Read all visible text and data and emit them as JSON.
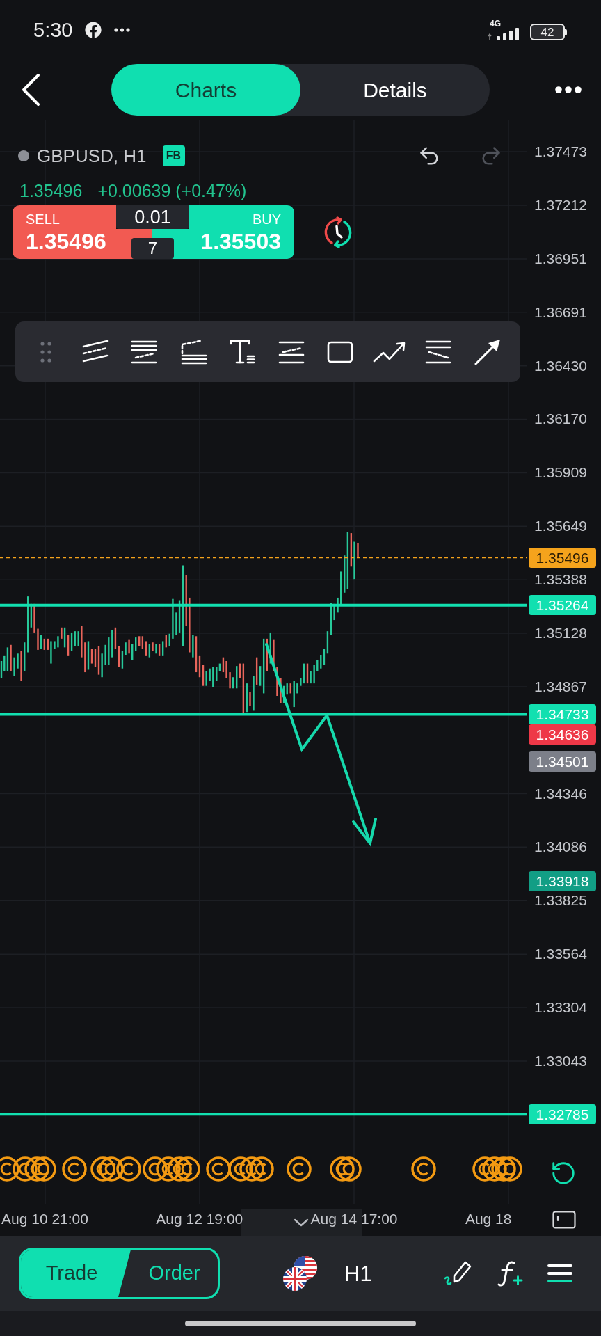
{
  "status_bar": {
    "time": "5:30",
    "network": "4G",
    "battery": "42"
  },
  "header": {
    "tabs": [
      {
        "label": "Charts",
        "selected": true
      },
      {
        "label": "Details",
        "selected": false
      }
    ]
  },
  "instrument": {
    "symbol": "GBPUSD, H1",
    "badge": "FB",
    "last_price": "1.35496",
    "change": "+0.00639 (+0.47%)"
  },
  "history_buttons": [
    {
      "kind": "undo",
      "disabled": false
    },
    {
      "kind": "redo",
      "disabled": true
    }
  ],
  "trade_panel": {
    "sell_label": "SELL",
    "sell_price": "1.35496",
    "volume": "0.01",
    "spread": "7",
    "buy_label": "BUY",
    "buy_price": "1.35503"
  },
  "price_axis": {
    "ticks": [
      "1.37473",
      "1.37212",
      "1.36951",
      "1.36691",
      "1.36430",
      "1.36170",
      "1.35909",
      "1.35649",
      "1.35388",
      "1.35128",
      "1.34867",
      "1.34346",
      "1.34086",
      "1.33825",
      "1.33564",
      "1.33304",
      "1.33043"
    ]
  },
  "price_tags": [
    {
      "value": "1.35496",
      "kind": "price",
      "color": "#f5a31c"
    },
    {
      "value": "1.35264",
      "kind": "level",
      "color": "#12e0b0"
    },
    {
      "value": "1.34733",
      "kind": "level",
      "color": "#12e0b0"
    },
    {
      "value": "1.34636",
      "kind": "marker",
      "color": "#ee3848"
    },
    {
      "value": "1.34501",
      "kind": "marker",
      "color": "#7c7f89"
    },
    {
      "value": "1.33918",
      "kind": "marker",
      "color": "#129e85"
    },
    {
      "value": "1.32785",
      "kind": "level",
      "color": "#12e0b0"
    }
  ],
  "time_axis": {
    "labels": [
      "Aug 10 21:00",
      "Aug 12 19:00",
      "Aug 14 17:00",
      "Aug 18"
    ]
  },
  "bottom_bar": {
    "modes": [
      {
        "label": "Trade",
        "selected": true
      },
      {
        "label": "Order",
        "selected": false
      }
    ],
    "timeframe": "H1"
  }
}
